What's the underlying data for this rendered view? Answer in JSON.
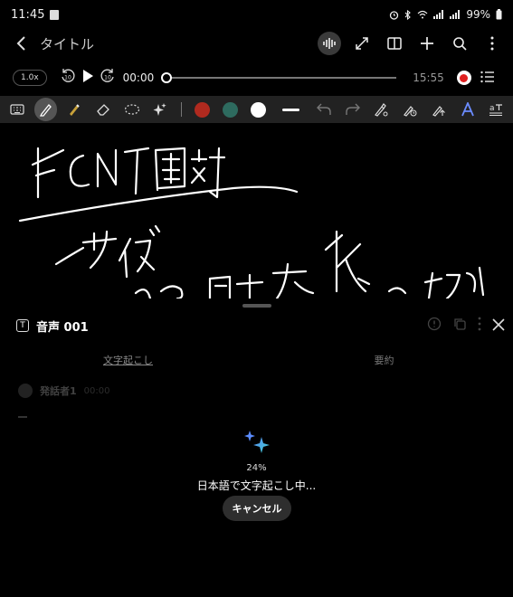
{
  "status": {
    "time": "11:45",
    "battery": "99%"
  },
  "header": {
    "title": "タイトル"
  },
  "audio": {
    "speed": "1.0x",
    "current": "00:00",
    "duration": "15:55",
    "progress": 0
  },
  "colors": {
    "red": "#b02a1f",
    "teal": "#2e6b5f",
    "white": "#ffffff",
    "accent": "#e02020"
  },
  "panel": {
    "recording_name": "音声 001",
    "tabs": [
      "文字起こし",
      "要約"
    ],
    "speaker_name": "発話者1",
    "speaker_time": "00:00",
    "percent": "24%",
    "progress_text": "日本語で文字起こし中...",
    "cancel_label": "キャンセル"
  }
}
